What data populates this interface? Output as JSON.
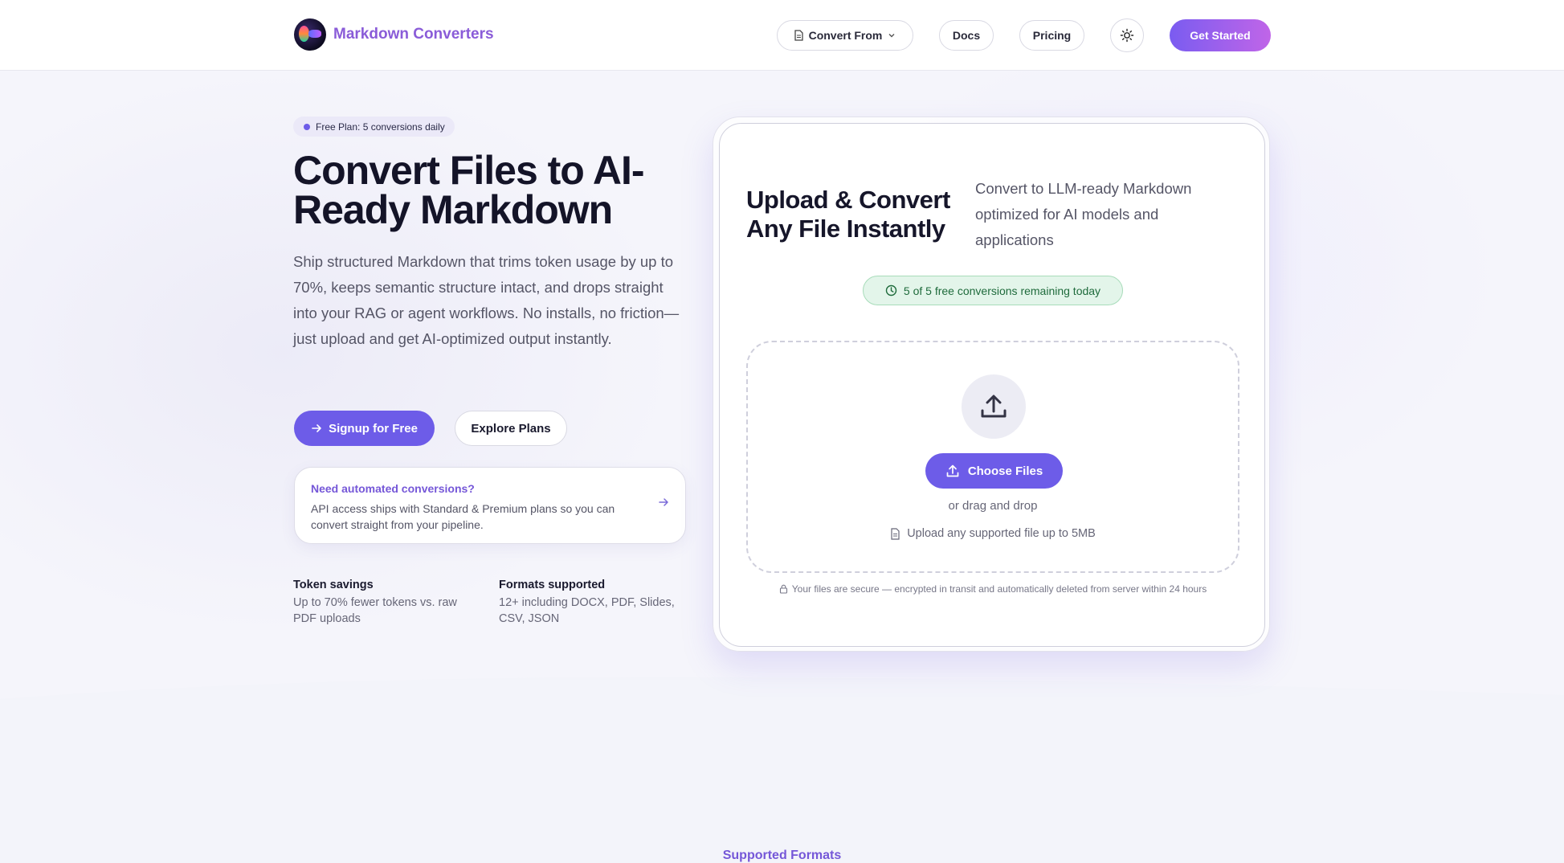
{
  "header": {
    "brand": "Markdown Converters",
    "nav": {
      "convert_from": "Convert From",
      "docs": "Docs",
      "pricing": "Pricing",
      "get_started": "Get Started"
    }
  },
  "hero": {
    "badge": "Free Plan: 5 conversions daily",
    "title": "Convert Files to AI-Ready Markdown",
    "description": "Ship structured Markdown that trims token usage by up to 70%, keeps semantic structure intact, and drops straight into your RAG or agent workflows. No installs, no friction—just upload and get AI-optimized output instantly.",
    "signup_label": "Signup for Free",
    "explore_label": "Explore Plans",
    "api_card": {
      "title": "Need automated conversions?",
      "text": "API access ships with Standard & Premium plans so you can convert straight from your pipeline."
    },
    "stats": [
      {
        "label": "Token savings",
        "value": "Up to 70% fewer tokens vs. raw PDF uploads"
      },
      {
        "label": "Formats supported",
        "value": "12+ including DOCX, PDF, Slides, CSV, JSON"
      }
    ]
  },
  "upload": {
    "title": "Upload & Convert Any File Instantly",
    "subtitle": "Convert to LLM-ready Markdown optimized for AI models and applications",
    "remaining": "5 of 5 free conversions remaining today",
    "choose_label": "Choose Files",
    "drag_text": "or drag and drop",
    "limit_text": "Upload any supported file up to 5MB",
    "secure_text": "Your files are secure — encrypted in transit and automatically deleted from server within 24 hours"
  },
  "section": {
    "supported_formats": "Supported Formats"
  },
  "colors": {
    "accent": "#6d5ce8",
    "brand_text": "#8a5cd8",
    "success_bg": "#e3f5ea"
  }
}
